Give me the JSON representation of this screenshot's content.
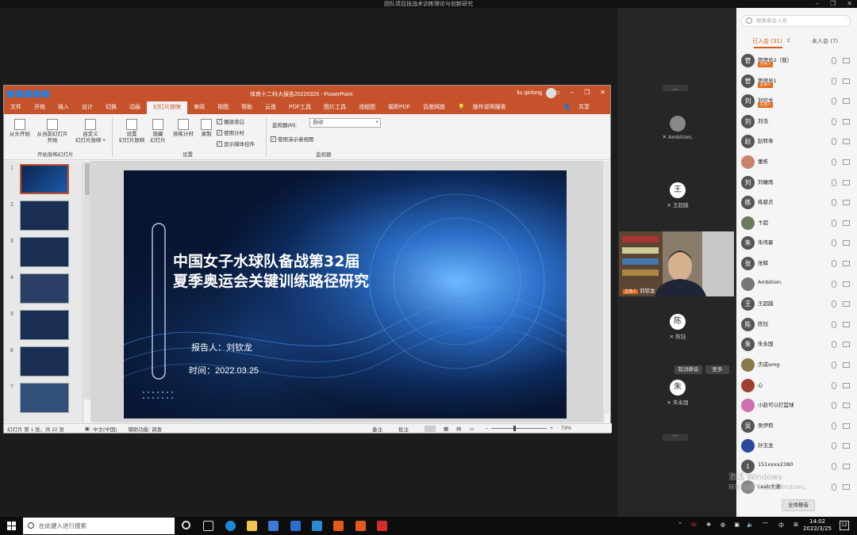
{
  "window": {
    "title": "团队项目技战术训练理论与创新研究"
  },
  "ppt": {
    "doc_title": "体育十二科大报告20220325 - PowerPoint",
    "user": "liu qinlong",
    "tabs": [
      "文件",
      "开始",
      "插入",
      "设计",
      "切换",
      "动画",
      "幻灯片放映",
      "审阅",
      "视图",
      "帮助",
      "云盘",
      "PDF工具",
      "图片工具",
      "流程图",
      "福昕PDF",
      "百度网盘",
      "操作说明搜索"
    ],
    "share": "共享",
    "ribbon": {
      "from_start": "从头开始",
      "from_current_1": "从当前幻灯片",
      "from_current_2": "开始",
      "custom_1": "自定义",
      "custom_2": "幻灯片放映 ˅",
      "group1": "开始放映幻灯片",
      "setup_1": "设置",
      "setup_2": "幻灯片放映",
      "hide_1": "隐藏",
      "hide_2": "幻灯片",
      "rehearse": "排练计时",
      "record": "录制",
      "chk_narration": "播放旁白",
      "chk_timing": "使用计时",
      "chk_media": "显示媒体控件",
      "group2": "设置",
      "monitor_label": "监视器(M):",
      "monitor_value": "自动",
      "presenter_view": "使用演示者视图",
      "group3": "监视器"
    },
    "thumb_numbers": [
      "1",
      "2",
      "3",
      "4",
      "5",
      "6",
      "7"
    ],
    "slide": {
      "title_line1": "中国女子水球队备战第32届",
      "title_line2": "夏季奥运会关键训练路径研究",
      "reporter": "报告人：刘钦龙",
      "date": "时间：2022.03.25"
    },
    "status": {
      "slide_count": "幻灯片 第 1 张，共 22 张",
      "language": "中文(中国)",
      "accessibility": "辅助功能: 调查",
      "notes": "备注",
      "comments": "批注",
      "zoom": "73%"
    }
  },
  "video_tiles": [
    {
      "avatar": "",
      "name": "Ambition."
    },
    {
      "avatar": "王",
      "name": "王超越"
    },
    {
      "avatar": "陈",
      "name": "陈钰"
    },
    {
      "avatar": "朱",
      "name": "朱永国"
    }
  ],
  "camera_name": "刘钦龙",
  "camera_tag": "主持人",
  "buttons": {
    "unmute_cancel": "取消静音",
    "more": "更多"
  },
  "panel": {
    "search_placeholder": "搜索参会人员",
    "tab_joined": "已入会 (31)",
    "tab_not_joined": "未入会 (7)",
    "all_mute": "全体静音",
    "participants": [
      {
        "avatar": "管",
        "name": "管理员2（我）",
        "tag": "主持人",
        "color": "#555555"
      },
      {
        "avatar": "管",
        "name": "管理员1",
        "tag": "主持人",
        "color": "#555555"
      },
      {
        "avatar": "刘",
        "name": "刘钦龙",
        "tag": "主持人",
        "color": "#555555"
      },
      {
        "avatar": "刘",
        "name": "刘浩",
        "tag": "",
        "color": "#555555"
      },
      {
        "avatar": "赵",
        "name": "赵转寿",
        "tag": "",
        "color": "#555555"
      },
      {
        "avatar": "",
        "name": "董栋",
        "tag": "",
        "color": "#c9836a"
      },
      {
        "avatar": "刘",
        "name": "刘瞰雨",
        "tag": "",
        "color": "#555555"
      },
      {
        "avatar": "练",
        "name": "练碧贞",
        "tag": "",
        "color": "#555555"
      },
      {
        "avatar": "",
        "name": "卞超",
        "tag": "",
        "color": "#6b7a5a"
      },
      {
        "avatar": "朱",
        "name": "朱伟豪",
        "tag": "",
        "color": "#555555"
      },
      {
        "avatar": "张",
        "name": "张辉",
        "tag": "",
        "color": "#555555"
      },
      {
        "avatar": "",
        "name": "Ambition.",
        "tag": "",
        "color": "#777777"
      },
      {
        "avatar": "王",
        "name": "王超越",
        "tag": "",
        "color": "#555555"
      },
      {
        "avatar": "陈",
        "name": "陈钰",
        "tag": "",
        "color": "#555555"
      },
      {
        "avatar": "朱",
        "name": "朱永国",
        "tag": "",
        "color": "#555555"
      },
      {
        "avatar": "",
        "name": "杰成omg",
        "tag": "",
        "color": "#8a7a4a"
      },
      {
        "avatar": "",
        "name": "心",
        "tag": "",
        "color": "#a04030"
      },
      {
        "avatar": "",
        "name": "小赵可以打篮球",
        "tag": "",
        "color": "#d070b0"
      },
      {
        "avatar": "吴",
        "name": "吴伊莉",
        "tag": "",
        "color": "#555555"
      },
      {
        "avatar": "",
        "name": "孙玉龙",
        "tag": "",
        "color": "#2a4a9a"
      },
      {
        "avatar": "1",
        "name": "151xxxx2380",
        "tag": "",
        "color": "#555555"
      },
      {
        "avatar": "",
        "name": "Leah大骆",
        "tag": "",
        "color": "#888888"
      }
    ]
  },
  "watermark": {
    "line1": "激活 Windows",
    "line2": "转到\"设置\"以激活 Windows。"
  },
  "taskbar": {
    "search_placeholder": "在此键入进行搜索",
    "ime": "中",
    "time": "14:02",
    "date": "2022/3/25"
  }
}
